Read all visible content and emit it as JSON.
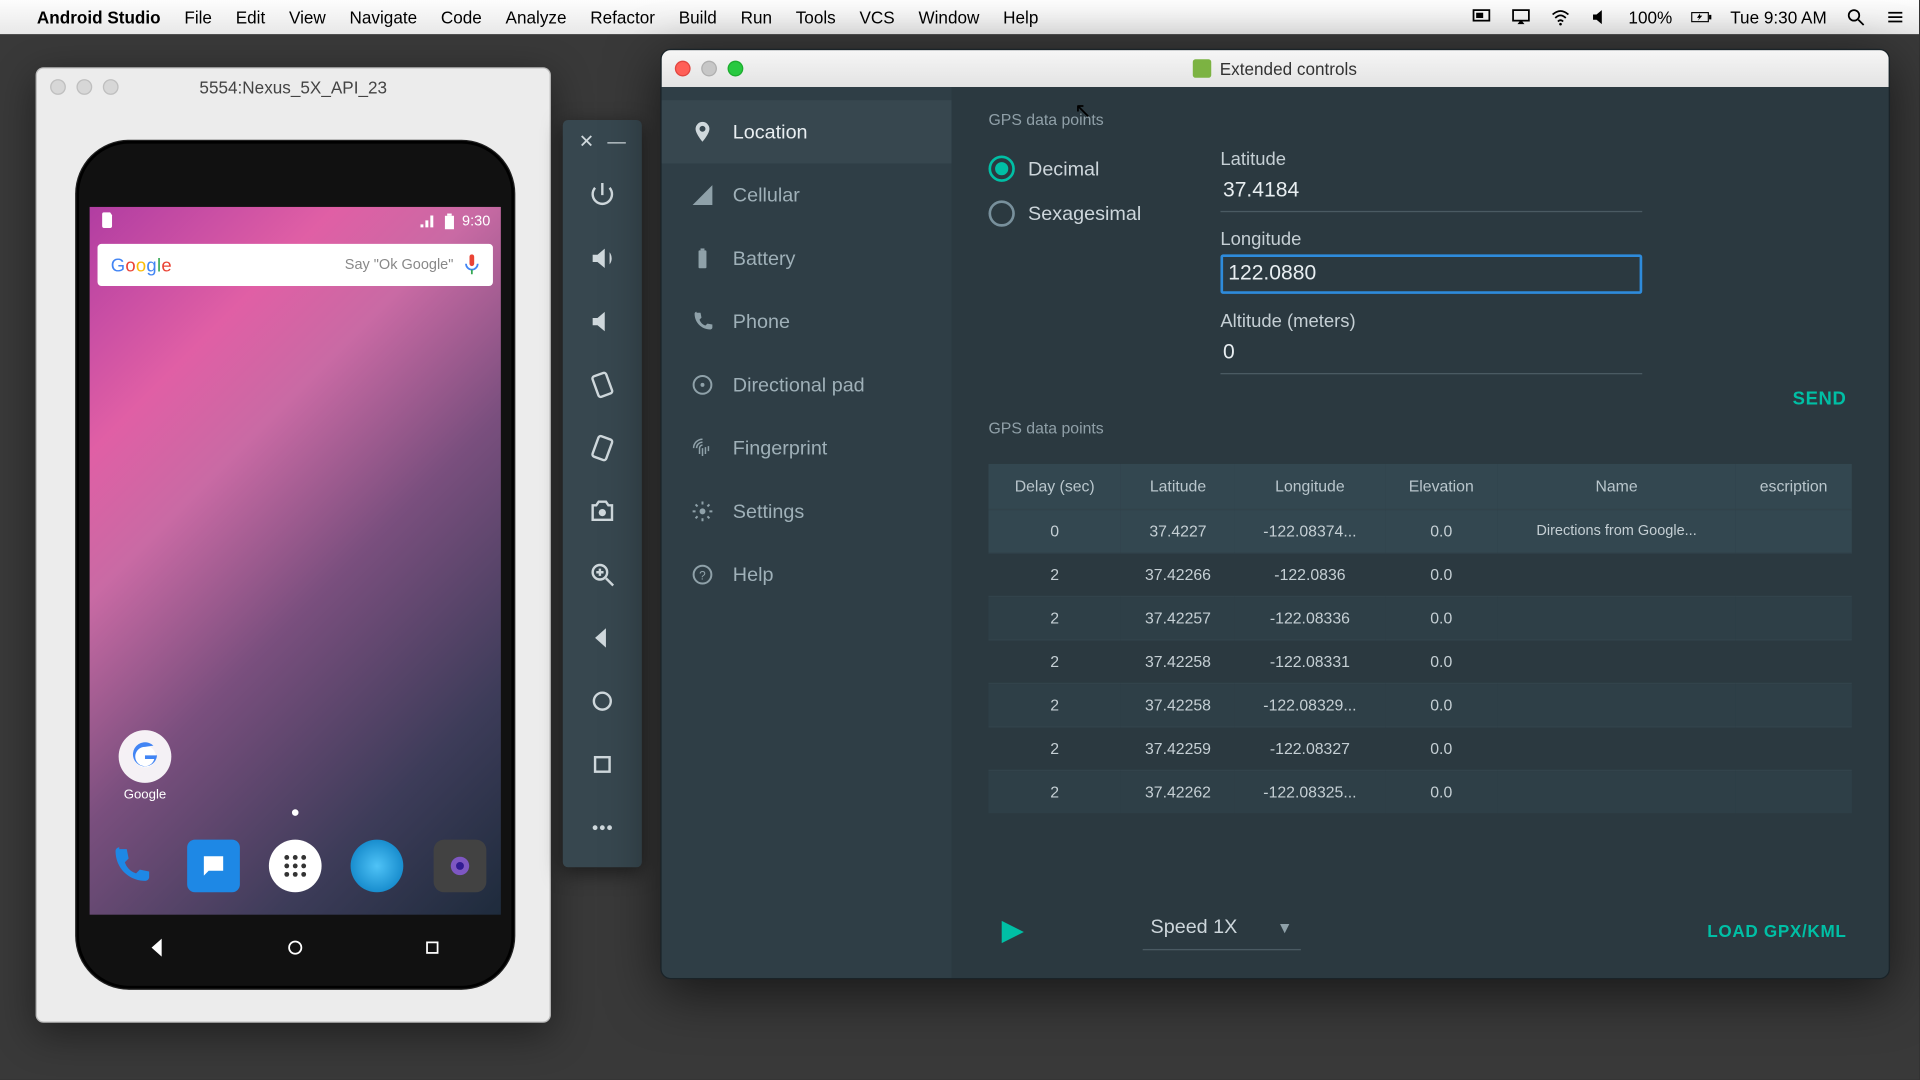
{
  "menubar": {
    "app": "Android Studio",
    "items": [
      "File",
      "Edit",
      "View",
      "Navigate",
      "Code",
      "Analyze",
      "Refactor",
      "Build",
      "Run",
      "Tools",
      "VCS",
      "Window",
      "Help"
    ],
    "battery": "100%",
    "clock": "Tue 9:30 AM"
  },
  "emulator": {
    "title": "5554:Nexus_5X_API_23",
    "status_time": "9:30",
    "search_hint": "Say \"Ok Google\"",
    "google_folder_label": "Google"
  },
  "extended": {
    "title": "Extended controls",
    "nav": [
      {
        "label": "Location",
        "icon": "pin",
        "active": true
      },
      {
        "label": "Cellular",
        "icon": "signal"
      },
      {
        "label": "Battery",
        "icon": "battery"
      },
      {
        "label": "Phone",
        "icon": "phone"
      },
      {
        "label": "Directional pad",
        "icon": "dpad"
      },
      {
        "label": "Fingerprint",
        "icon": "finger"
      },
      {
        "label": "Settings",
        "icon": "gear"
      },
      {
        "label": "Help",
        "icon": "help"
      }
    ],
    "gps_label": "GPS data points",
    "coord_mode": {
      "decimal": "Decimal",
      "sexagesimal": "Sexagesimal",
      "selected": "decimal"
    },
    "fields": {
      "lat_label": "Latitude",
      "lat_value": "37.4184",
      "lon_label": "Longitude",
      "lon_value": "122.0880",
      "alt_label": "Altitude (meters)",
      "alt_value": "0"
    },
    "send_label": "SEND",
    "table": {
      "headers": [
        "Delay (sec)",
        "Latitude",
        "Longitude",
        "Elevation",
        "Name",
        "escription"
      ],
      "rows": [
        [
          "0",
          "37.4227",
          "-122.08374...",
          "0.0",
          "Directions from Google...",
          ""
        ],
        [
          "2",
          "37.42266",
          "-122.0836",
          "0.0",
          "",
          ""
        ],
        [
          "2",
          "37.42257",
          "-122.08336",
          "0.0",
          "",
          ""
        ],
        [
          "2",
          "37.42258",
          "-122.08331",
          "0.0",
          "",
          ""
        ],
        [
          "2",
          "37.42258",
          "-122.08329...",
          "0.0",
          "",
          ""
        ],
        [
          "2",
          "37.42259",
          "-122.08327",
          "0.0",
          "",
          ""
        ],
        [
          "2",
          "37.42262",
          "-122.08325...",
          "0.0",
          "",
          ""
        ]
      ]
    },
    "speed_label": "Speed 1X",
    "load_label": "LOAD GPX/KML"
  },
  "chart_data": {
    "type": "table",
    "title": "GPS data points",
    "columns": [
      "Delay (sec)",
      "Latitude",
      "Longitude",
      "Elevation",
      "Name",
      "Description"
    ],
    "rows": [
      {
        "delay_sec": 0,
        "latitude": 37.4227,
        "longitude": -122.08374,
        "elevation": 0.0,
        "name": "Directions from Google...",
        "description": ""
      },
      {
        "delay_sec": 2,
        "latitude": 37.42266,
        "longitude": -122.0836,
        "elevation": 0.0,
        "name": "",
        "description": ""
      },
      {
        "delay_sec": 2,
        "latitude": 37.42257,
        "longitude": -122.08336,
        "elevation": 0.0,
        "name": "",
        "description": ""
      },
      {
        "delay_sec": 2,
        "latitude": 37.42258,
        "longitude": -122.08331,
        "elevation": 0.0,
        "name": "",
        "description": ""
      },
      {
        "delay_sec": 2,
        "latitude": 37.42258,
        "longitude": -122.08329,
        "elevation": 0.0,
        "name": "",
        "description": ""
      },
      {
        "delay_sec": 2,
        "latitude": 37.42259,
        "longitude": -122.08327,
        "elevation": 0.0,
        "name": "",
        "description": ""
      },
      {
        "delay_sec": 2,
        "latitude": 37.42262,
        "longitude": -122.08325,
        "elevation": 0.0,
        "name": "",
        "description": ""
      }
    ]
  }
}
